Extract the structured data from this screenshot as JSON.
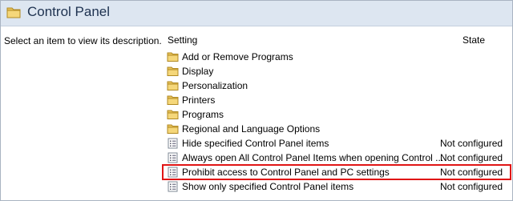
{
  "window": {
    "title": "Control Panel"
  },
  "description": "Select an item to view its description.",
  "columns": {
    "setting": "Setting",
    "state": "State"
  },
  "rows": [
    {
      "type": "folder",
      "label": "Add or Remove Programs",
      "state": ""
    },
    {
      "type": "folder",
      "label": "Display",
      "state": ""
    },
    {
      "type": "folder",
      "label": "Personalization",
      "state": ""
    },
    {
      "type": "folder",
      "label": "Printers",
      "state": ""
    },
    {
      "type": "folder",
      "label": "Programs",
      "state": ""
    },
    {
      "type": "folder",
      "label": "Regional and Language Options",
      "state": ""
    },
    {
      "type": "setting",
      "label": "Hide specified Control Panel items",
      "state": "Not configured"
    },
    {
      "type": "setting",
      "label": "Always open All Control Panel Items when opening Control ...",
      "state": "Not configured"
    },
    {
      "type": "setting",
      "label": "Prohibit access to Control Panel and PC settings",
      "state": "Not configured",
      "highlighted": true
    },
    {
      "type": "setting",
      "label": "Show only specified Control Panel items",
      "state": "Not configured"
    }
  ],
  "colors": {
    "highlight_border": "#e01515",
    "header_bg": "#dde6f1"
  },
  "icons": {
    "folder": "folder-icon",
    "setting": "policy-setting-icon"
  }
}
